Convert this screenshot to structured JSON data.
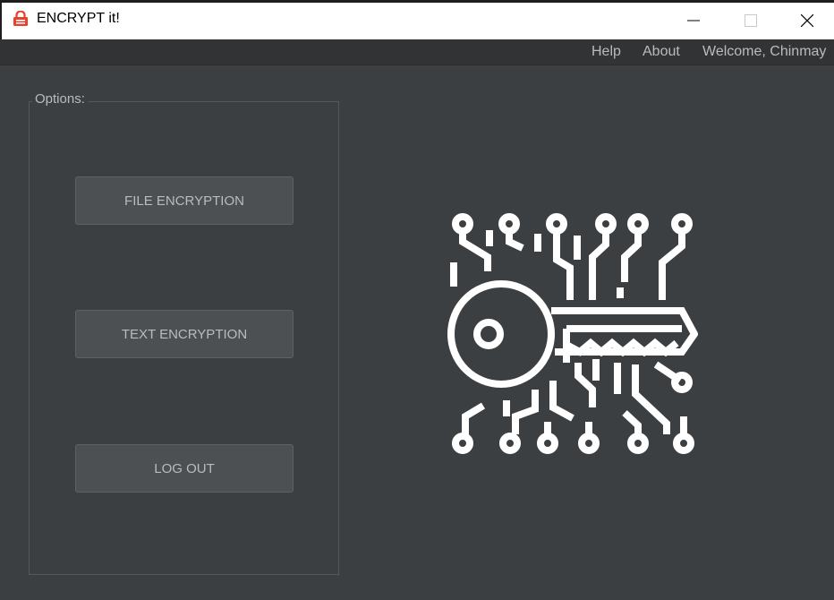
{
  "window": {
    "title": "ENCRYPT it!",
    "app_icon": "red-lock-icon"
  },
  "menu": {
    "help": "Help",
    "about": "About",
    "welcome": "Welcome, Chinmay"
  },
  "options": {
    "legend": "Options:",
    "buttons": [
      {
        "label": "FILE ENCRYPTION"
      },
      {
        "label": "TEXT ENCRYPTION"
      },
      {
        "label": "LOG OUT"
      }
    ]
  },
  "illustration": {
    "icon": "digital-key-circuit-icon"
  },
  "colors": {
    "background": "#3c3f41",
    "menubar": "#313335",
    "button": "#4c5052",
    "text": "#bbbbbb",
    "icon_accent": "#e8412c"
  }
}
